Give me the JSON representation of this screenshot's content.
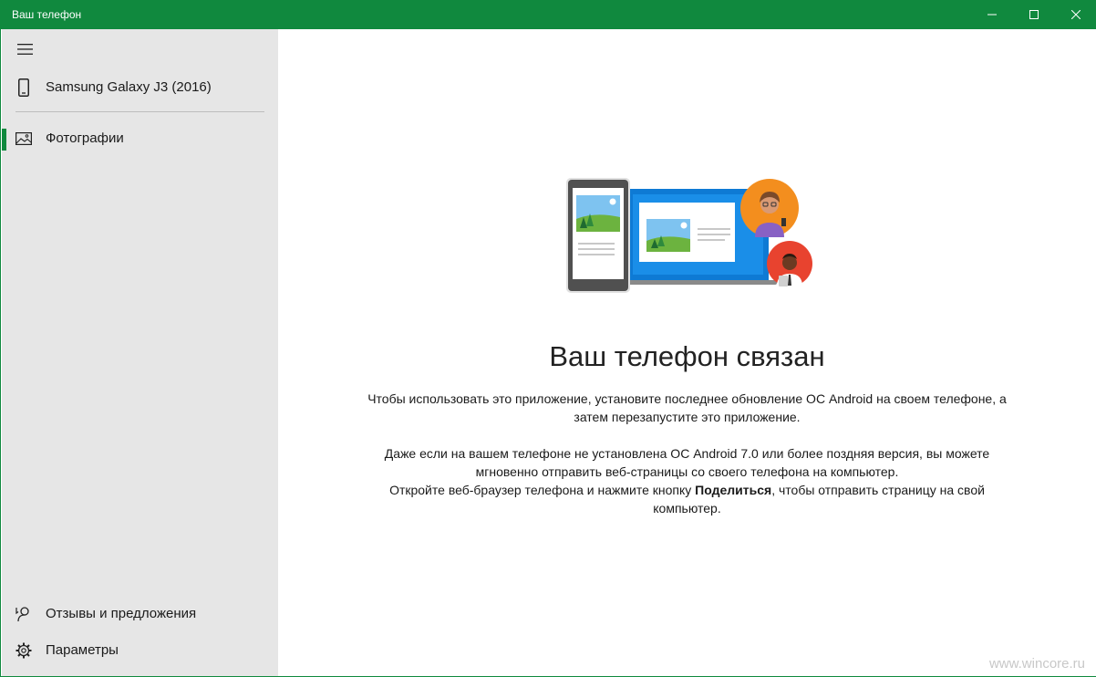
{
  "window": {
    "title": "Ваш телефон",
    "controls": [
      "minimize-icon",
      "maximize-icon",
      "close-icon"
    ]
  },
  "sidebar": {
    "menu_icon": "hamburger-icon",
    "device": {
      "label": "Samsung Galaxy J3 (2016)",
      "icon": "phone-icon"
    },
    "items": [
      {
        "label": "Фотографии",
        "icon": "photos-icon",
        "selected": true
      }
    ],
    "footer": [
      {
        "label": "Отзывы и предложения",
        "icon": "feedback-icon"
      },
      {
        "label": "Параметры",
        "icon": "gear-icon"
      }
    ]
  },
  "main": {
    "heading": "Ваш телефон связан",
    "para1": "Чтобы использовать это приложение, установите последнее обновление ОС Android на своем телефоне, а затем перезапустите это приложение.",
    "para2": "Даже если на вашем телефоне не установлена ОС Android 7.0 или более поздняя версия, вы можете мгновенно отправить веб-страницы со своего телефона на компьютер.",
    "para3_before": "Откройте веб-браузер телефона и нажмите кнопку ",
    "para3_bold": "Поделиться",
    "para3_after": ", чтобы отправить страницу на свой компьютер."
  },
  "watermark": "www.wincore.ru",
  "colors": {
    "accent": "#10893e",
    "sidebar_bg": "#e6e6e6"
  }
}
